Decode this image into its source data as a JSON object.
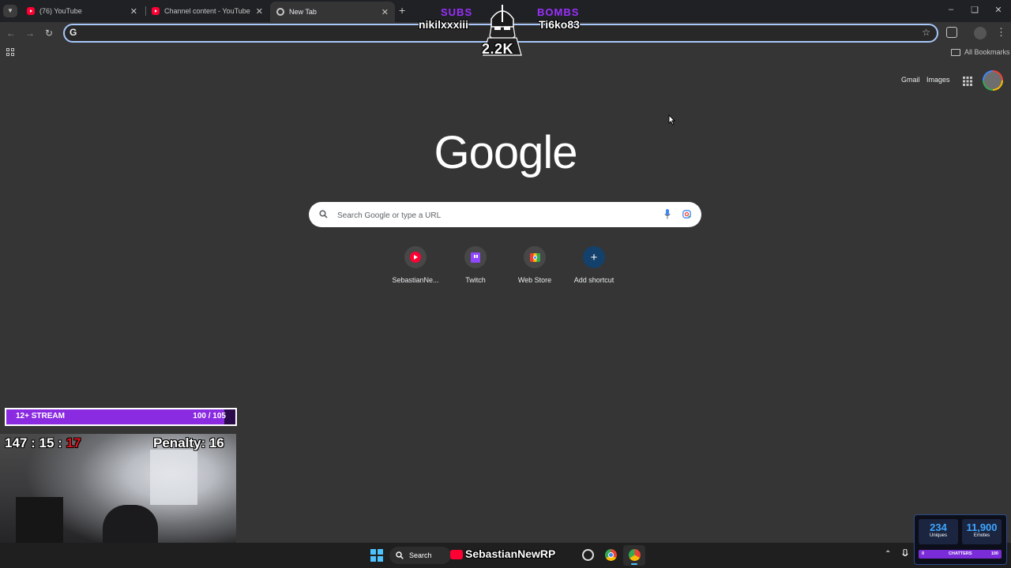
{
  "tabs": [
    {
      "title": "(76) YouTube",
      "icon": "youtube-icon"
    },
    {
      "title": "Channel content - YouTube Studio",
      "icon": "youtube-icon"
    },
    {
      "title": "New Tab",
      "icon": "chrome-icon",
      "active": true
    }
  ],
  "omnibox": {
    "value": "",
    "placeholder": ""
  },
  "bookmarks": {
    "all_label": "All Bookmarks"
  },
  "ntp": {
    "gmail": "Gmail",
    "images": "Images",
    "logo": "Google",
    "search_placeholder": "Search Google or type a URL",
    "shortcuts": [
      {
        "label": "SebastianNe...",
        "icon": "youtube-icon"
      },
      {
        "label": "Twitch",
        "icon": "twitch-icon"
      },
      {
        "label": "Web Store",
        "icon": "web-store-icon"
      },
      {
        "label": "Add shortcut",
        "icon": "plus-icon"
      }
    ]
  },
  "overlay": {
    "subs_label": "SUBS",
    "subs_name": "nikilxxxiii",
    "bombs_label": "BOMBS",
    "bombs_name": "Ti6ko83",
    "center_count": "2.2K",
    "goal_label": "12+ STREAM",
    "goal_progress": "100 / 105",
    "goal_fraction": 0.952,
    "timer_h": "147",
    "timer_sep": ":",
    "timer_m": "15",
    "timer_s": "17",
    "penalty": "Penalty: 16",
    "uniques_value": "234",
    "uniques_label": "Uniques",
    "emotes_value": "11,900",
    "emotes_label": "Emotes",
    "chatters_min": "0",
    "chatters_label": "CHATTERS",
    "chatters_max": "100"
  },
  "taskbar": {
    "search_label": "Search",
    "stream_name": "SebastianNewRP"
  },
  "colors": {
    "accent_purple": "#8a2be2",
    "omnibox_focus": "#a8c7fa",
    "timer_red": "#e0141e",
    "stats_blue": "#3ea6ff"
  }
}
